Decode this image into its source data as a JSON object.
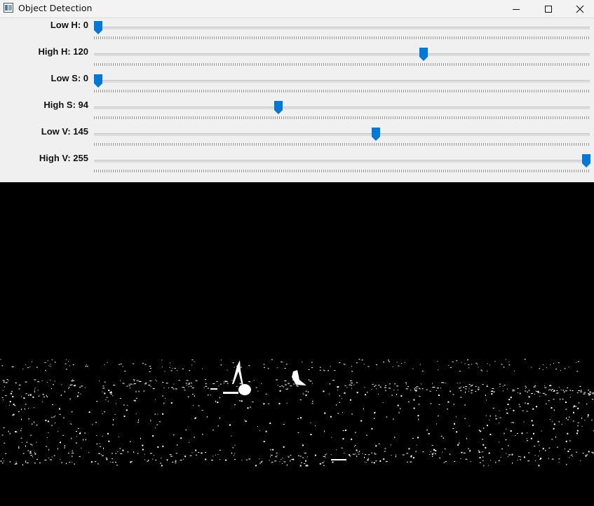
{
  "window": {
    "title": "Object Detection",
    "icons": {
      "app": "opencv-window-icon",
      "minimize": "minimize-icon",
      "maximize": "maximize-icon",
      "close": "close-icon"
    }
  },
  "trackbars": [
    {
      "label": "Low H: 0",
      "value": 0,
      "max": 255
    },
    {
      "label": "High H: 120",
      "value": 120,
      "max": 180
    },
    {
      "label": "Low S: 0",
      "value": 0,
      "max": 255
    },
    {
      "label": "High S: 94",
      "value": 94,
      "max": 255
    },
    {
      "label": "Low V: 145",
      "value": 145,
      "max": 255
    },
    {
      "label": "High V: 255",
      "value": 255,
      "max": 255
    }
  ],
  "colors": {
    "accent": "#0078d7",
    "panel": "#f0f0f0",
    "mask_background": "#000000",
    "mask_foreground": "#ffffff"
  }
}
